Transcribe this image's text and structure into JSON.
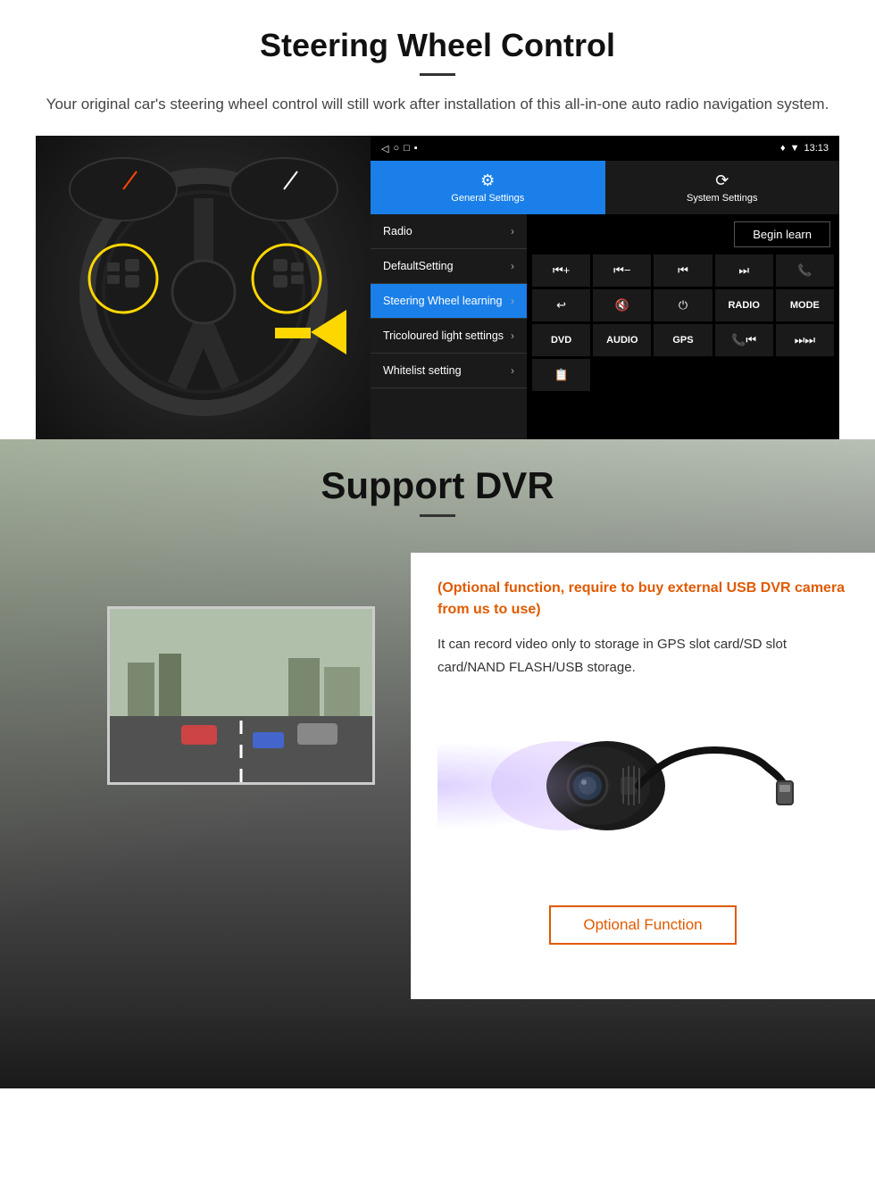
{
  "steering": {
    "title": "Steering Wheel Control",
    "subtitle": "Your original car's steering wheel control will still work after installation of this all-in-one auto radio navigation system.",
    "statusbar": {
      "time": "13:13",
      "icons": [
        "▶",
        "◯",
        "□",
        "■"
      ]
    },
    "tabs": [
      {
        "icon": "⚙",
        "label": "General Settings",
        "active": true
      },
      {
        "icon": "⟳",
        "label": "System Settings",
        "active": false
      }
    ],
    "menu_items": [
      {
        "label": "Radio",
        "active": false
      },
      {
        "label": "DefaultSetting",
        "active": false
      },
      {
        "label": "Steering Wheel learning",
        "active": true
      },
      {
        "label": "Tricoloured light settings",
        "active": false
      },
      {
        "label": "Whitelist setting",
        "active": false
      }
    ],
    "begin_learn": "Begin learn",
    "ctrl_buttons": [
      "⏮+",
      "⏮-",
      "⏮⏮",
      "⏭⏭",
      "📞",
      "↩",
      "🔇×",
      "⏻",
      "RADIO",
      "MODE",
      "DVD",
      "AUDIO",
      "GPS",
      "📞⏮",
      "⏭"
    ],
    "extra_btn": "📋"
  },
  "dvr": {
    "title": "Support DVR",
    "optional_note": "(Optional function, require to buy external USB DVR camera from us to use)",
    "description": "It can record video only to storage in GPS slot card/SD slot card/NAND FLASH/USB storage.",
    "optional_function_label": "Optional Function"
  }
}
